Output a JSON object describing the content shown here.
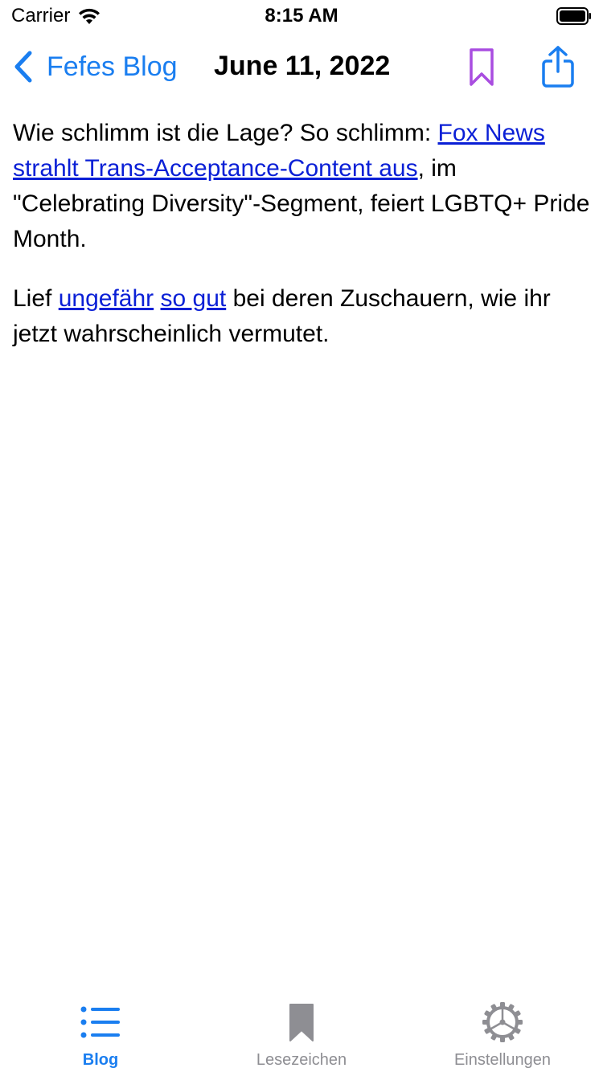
{
  "status_bar": {
    "carrier": "Carrier",
    "time": "8:15 AM",
    "wifi_icon": "wifi-icon",
    "battery_icon": "battery-full-icon"
  },
  "nav": {
    "back_label": "Fefes Blog",
    "title": "June 11, 2022",
    "bookmark_icon": "bookmark-outline-icon",
    "share_icon": "share-icon",
    "colors": {
      "accent": "#1a7ef0",
      "bookmark": "#a94de0"
    }
  },
  "post": {
    "paragraph1": {
      "text_before": "Wie schlimm ist die Lage? So schlimm: ",
      "link": "Fox News strahlt Trans-Acceptance-Content aus",
      "text_after": ", im \"Celebrating Diversity\"-Segment, feiert LGBTQ+ Pride Month."
    },
    "paragraph2": {
      "text_before": "Lief ",
      "link1": "ungefähr",
      "between": " ",
      "link2": "so gut",
      "text_after": " bei deren Zuschauern, wie ihr jetzt wahrscheinlich vermutet."
    },
    "link_color": "#0a1fd6"
  },
  "tab_bar": {
    "items": [
      {
        "label": "Blog",
        "icon": "list-icon",
        "active": true
      },
      {
        "label": "Lesezeichen",
        "icon": "bookmark-filled-icon",
        "active": false
      },
      {
        "label": "Einstellungen",
        "icon": "gear-icon",
        "active": false
      }
    ],
    "active_color": "#1a7ef0",
    "inactive_color": "#8e8e93"
  }
}
